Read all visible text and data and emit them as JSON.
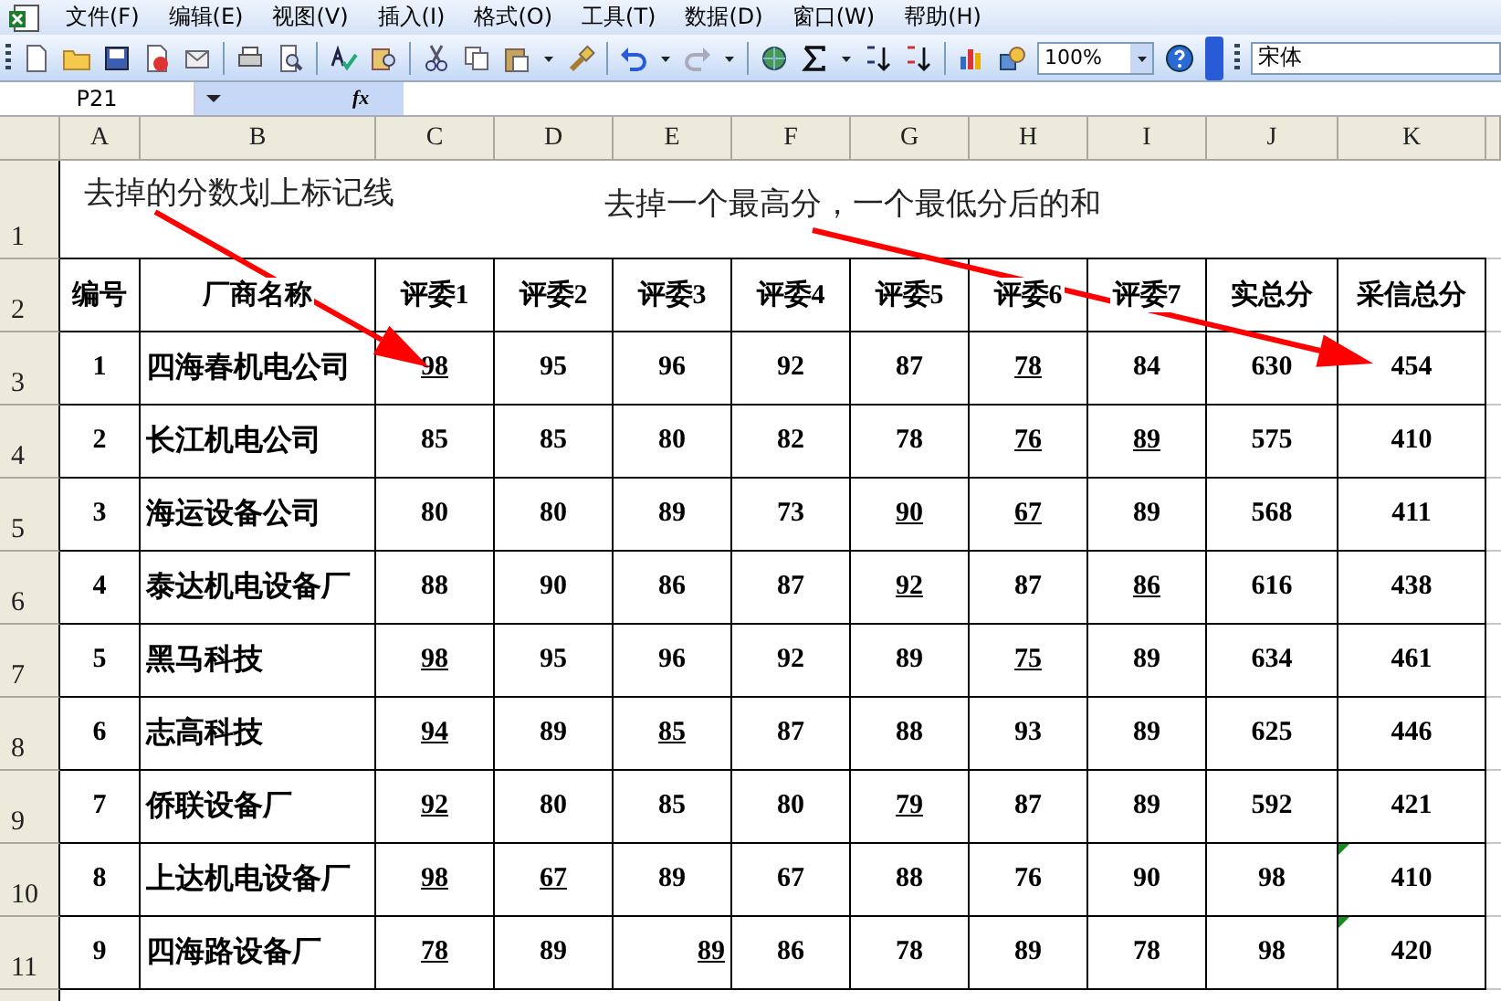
{
  "menu": [
    "文件(F)",
    "编辑(E)",
    "视图(V)",
    "插入(I)",
    "格式(O)",
    "工具(T)",
    "数据(D)",
    "窗口(W)",
    "帮助(H)"
  ],
  "toolbar": {
    "zoom": "100%",
    "font": "宋体"
  },
  "formula_bar": {
    "name_box": "P21",
    "fx": "fx"
  },
  "sheet": {
    "columns": [
      "A",
      "B",
      "C",
      "D",
      "E",
      "F",
      "G",
      "H",
      "I",
      "J",
      "K"
    ],
    "row_numbers": [
      "1",
      "2",
      "3",
      "4",
      "5",
      "6",
      "7",
      "8",
      "9",
      "10",
      "11"
    ],
    "notes": [
      "去掉的分数划上标记线",
      "去掉一个最高分，一个最低分后的和"
    ],
    "table": {
      "columns": [
        "编号",
        "厂商名称",
        "评委1",
        "评委2",
        "评委3",
        "评委4",
        "评委5",
        "评委6",
        "评委7",
        "实总分",
        "采信总分"
      ],
      "rows": [
        {
          "number": "1",
          "name": "四海春机电公司",
          "scores": [
            {
              "text": "98",
              "underlined": true,
              "right_aligned": false
            },
            {
              "text": "95",
              "underlined": false,
              "right_aligned": false
            },
            {
              "text": "96",
              "underlined": false,
              "right_aligned": false
            },
            {
              "text": "92",
              "underlined": false,
              "right_aligned": false
            },
            {
              "text": "87",
              "underlined": false,
              "right_aligned": false
            },
            {
              "text": "78",
              "underlined": true,
              "right_aligned": false
            },
            {
              "text": "84",
              "underlined": false,
              "right_aligned": false
            }
          ],
          "total": "630",
          "adopted_total": "454",
          "error_indicator": false
        },
        {
          "number": "2",
          "name": "长江机电公司",
          "scores": [
            {
              "text": "85",
              "underlined": false,
              "right_aligned": false
            },
            {
              "text": "85",
              "underlined": false,
              "right_aligned": false
            },
            {
              "text": "80",
              "underlined": false,
              "right_aligned": false
            },
            {
              "text": "82",
              "underlined": false,
              "right_aligned": false
            },
            {
              "text": "78",
              "underlined": false,
              "right_aligned": false
            },
            {
              "text": "76",
              "underlined": true,
              "right_aligned": false
            },
            {
              "text": "89",
              "underlined": true,
              "right_aligned": false
            }
          ],
          "total": "575",
          "adopted_total": "410",
          "error_indicator": false
        },
        {
          "number": "3",
          "name": "海运设备公司",
          "scores": [
            {
              "text": "80",
              "underlined": false,
              "right_aligned": false
            },
            {
              "text": "80",
              "underlined": false,
              "right_aligned": false
            },
            {
              "text": "89",
              "underlined": false,
              "right_aligned": false
            },
            {
              "text": "73",
              "underlined": false,
              "right_aligned": false
            },
            {
              "text": "90",
              "underlined": true,
              "right_aligned": false
            },
            {
              "text": "67",
              "underlined": true,
              "right_aligned": false
            },
            {
              "text": "89",
              "underlined": false,
              "right_aligned": false
            }
          ],
          "total": "568",
          "adopted_total": "411",
          "error_indicator": false
        },
        {
          "number": "4",
          "name": "泰达机电设备厂",
          "scores": [
            {
              "text": "88",
              "underlined": false,
              "right_aligned": false
            },
            {
              "text": "90",
              "underlined": false,
              "right_aligned": false
            },
            {
              "text": "86",
              "underlined": false,
              "right_aligned": false
            },
            {
              "text": "87",
              "underlined": false,
              "right_aligned": false
            },
            {
              "text": "92",
              "underlined": true,
              "right_aligned": false
            },
            {
              "text": "87",
              "underlined": false,
              "right_aligned": false
            },
            {
              "text": "86",
              "underlined": true,
              "right_aligned": false
            }
          ],
          "total": "616",
          "adopted_total": "438",
          "error_indicator": false
        },
        {
          "number": "5",
          "name": "黑马科技",
          "scores": [
            {
              "text": "98",
              "underlined": true,
              "right_aligned": false
            },
            {
              "text": "95",
              "underlined": false,
              "right_aligned": false
            },
            {
              "text": "96",
              "underlined": false,
              "right_aligned": false
            },
            {
              "text": "92",
              "underlined": false,
              "right_aligned": false
            },
            {
              "text": "89",
              "underlined": false,
              "right_aligned": false
            },
            {
              "text": "75",
              "underlined": true,
              "right_aligned": false
            },
            {
              "text": "89",
              "underlined": false,
              "right_aligned": false
            }
          ],
          "total": "634",
          "adopted_total": "461",
          "error_indicator": false
        },
        {
          "number": "6",
          "name": "志高科技",
          "scores": [
            {
              "text": "94",
              "underlined": true,
              "right_aligned": false
            },
            {
              "text": "89",
              "underlined": false,
              "right_aligned": false
            },
            {
              "text": "85",
              "underlined": true,
              "right_aligned": false
            },
            {
              "text": "87",
              "underlined": false,
              "right_aligned": false
            },
            {
              "text": "88",
              "underlined": false,
              "right_aligned": false
            },
            {
              "text": "93",
              "underlined": false,
              "right_aligned": false
            },
            {
              "text": "89",
              "underlined": false,
              "right_aligned": false
            }
          ],
          "total": "625",
          "adopted_total": "446",
          "error_indicator": false
        },
        {
          "number": "7",
          "name": "侨联设备厂",
          "scores": [
            {
              "text": "92",
              "underlined": true,
              "right_aligned": false
            },
            {
              "text": "80",
              "underlined": false,
              "right_aligned": false
            },
            {
              "text": "85",
              "underlined": false,
              "right_aligned": false
            },
            {
              "text": "80",
              "underlined": false,
              "right_aligned": false
            },
            {
              "text": "79",
              "underlined": true,
              "right_aligned": false
            },
            {
              "text": "87",
              "underlined": false,
              "right_aligned": false
            },
            {
              "text": "89",
              "underlined": false,
              "right_aligned": false
            }
          ],
          "total": "592",
          "adopted_total": "421",
          "error_indicator": false
        },
        {
          "number": "8",
          "name": "上达机电设备厂",
          "scores": [
            {
              "text": "98",
              "underlined": true,
              "right_aligned": false
            },
            {
              "text": "67",
              "underlined": true,
              "right_aligned": false
            },
            {
              "text": "89",
              "underlined": false,
              "right_aligned": false
            },
            {
              "text": "67",
              "underlined": false,
              "right_aligned": false
            },
            {
              "text": "88",
              "underlined": false,
              "right_aligned": false
            },
            {
              "text": "76",
              "underlined": false,
              "right_aligned": false
            },
            {
              "text": "90",
              "underlined": false,
              "right_aligned": false
            }
          ],
          "total": "98",
          "adopted_total": "410",
          "error_indicator": true
        },
        {
          "number": "9",
          "name": "四海路设备厂",
          "scores": [
            {
              "text": "78",
              "underlined": true,
              "right_aligned": false
            },
            {
              "text": "89",
              "underlined": false,
              "right_aligned": false
            },
            {
              "text": "89",
              "underlined": true,
              "right_aligned": true
            },
            {
              "text": "86",
              "underlined": false,
              "right_aligned": false
            },
            {
              "text": "78",
              "underlined": false,
              "right_aligned": false
            },
            {
              "text": "89",
              "underlined": false,
              "right_aligned": false
            },
            {
              "text": "78",
              "underlined": false,
              "right_aligned": false
            }
          ],
          "total": "98",
          "adopted_total": "420",
          "error_indicator": true
        }
      ]
    }
  }
}
